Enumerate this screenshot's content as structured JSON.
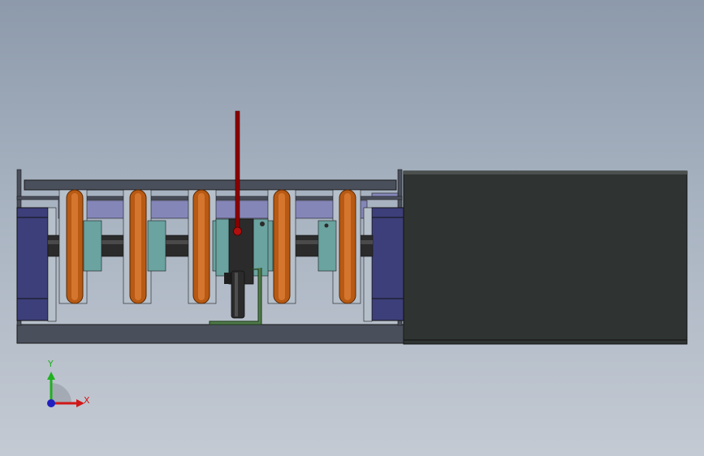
{
  "triad": {
    "x_label": "X",
    "y_label": "Y",
    "x_color": "#d01818",
    "y_color": "#20b020",
    "z_color": "#2020c0"
  },
  "colors": {
    "background_top": "#8d9aab",
    "background_bottom": "#c4cad3",
    "motor_body": "#2f3432",
    "frame": "#4a4f5c",
    "end_block": "#3d3f7a",
    "rail": "#8586b8",
    "wheel_hub": "#6aa3a0",
    "o_ring": "#b85a14",
    "shaft": "#2b2b2b",
    "sensor_rod": "#8a0000",
    "bracket": "#4f7a4a"
  }
}
